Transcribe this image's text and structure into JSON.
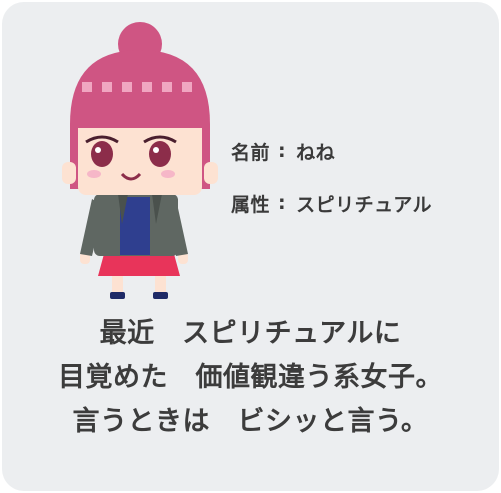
{
  "profile": {
    "name_label": "名前",
    "name_value": "ねね",
    "attribute_label": "属性",
    "attribute_value": "スピリチュアル",
    "separator": ":"
  },
  "description": {
    "line1": "最近　スピリチュアルに",
    "line2": "目覚めた　価値観違う系女子。",
    "line3": "言うときは　ビシッと言う。"
  },
  "colors": {
    "card_background": "#eceef0",
    "hair": "#d1577f",
    "skin": "#fde2d2",
    "jacket": "#5f6762",
    "shirt": "#2f3f8f",
    "skirt": "#e8345a"
  }
}
